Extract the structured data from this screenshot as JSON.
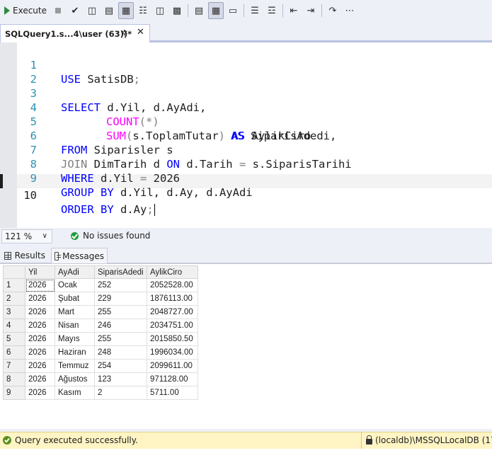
{
  "toolbar": {
    "execute_label": "Execute"
  },
  "tab": {
    "title": "SQLQuery1.s...4\\user (63))*",
    "pin": "✲",
    "close": "✕"
  },
  "editor": {
    "lines": [
      {
        "n": "1"
      },
      {
        "n": "2"
      },
      {
        "n": "3"
      },
      {
        "n": "4"
      },
      {
        "n": "5"
      },
      {
        "n": "6"
      },
      {
        "n": "7"
      },
      {
        "n": "8"
      },
      {
        "n": "9"
      },
      {
        "n": "10"
      }
    ],
    "tokens": {
      "use": "USE",
      "db": " SatisDB",
      "select": "SELECT",
      "sel_cols": " d.Yil, d.AyAdi,",
      "count": "COUNT",
      "count_args": "(*)",
      "as1": "AS",
      "alias1": " SiparisAdedi,",
      "sum": "SUM",
      "sum_args_open": "(",
      "sum_col": "s.ToplamTutar",
      "sum_args_close": ")",
      "as2": "AS",
      "alias2": " AylikCiro",
      "from": "FROM",
      "from_tbl": " Siparisler s",
      "join": "JOIN",
      "join_tbl": " DimTarih d ",
      "on": "ON",
      "join_cond": " d.Tarih ",
      "eq": "=",
      "join_cond2": " s.SiparisTarihi",
      "where": "WHERE",
      "where_col": " d.Yil ",
      "where_val": " 2026",
      "group": "GROUP BY",
      "group_cols": " d.Yil, d.Ay, d.AyAdi",
      "order": "ORDER BY",
      "order_cols": " d.Ay",
      "semicolon": ";"
    }
  },
  "editor_status": {
    "zoom": "121 %",
    "issues": "No issues found"
  },
  "results_tabs": {
    "results": "Results",
    "messages": "Messages"
  },
  "results": {
    "columns": [
      "",
      "Yil",
      "AyAdi",
      "SiparisAdedi",
      "AylikCiro"
    ],
    "rows": [
      [
        "1",
        "2026",
        "Ocak",
        "252",
        "2052528.00"
      ],
      [
        "2",
        "2026",
        "Şubat",
        "229",
        "1876113.00"
      ],
      [
        "3",
        "2026",
        "Mart",
        "255",
        "2048727.00"
      ],
      [
        "4",
        "2026",
        "Nisan",
        "246",
        "2034751.00"
      ],
      [
        "5",
        "2026",
        "Mayıs",
        "255",
        "2015850.50"
      ],
      [
        "6",
        "2026",
        "Haziran",
        "248",
        "1996034.00"
      ],
      [
        "7",
        "2026",
        "Temmuz",
        "254",
        "2099611.00"
      ],
      [
        "8",
        "2026",
        "Ağustos",
        "123",
        "971128.00"
      ],
      [
        "9",
        "2026",
        "Kasım",
        "2",
        "5711.00"
      ]
    ]
  },
  "statusbar": {
    "message": "Query executed successfully.",
    "server": "(localdb)\\MSSQLLocalDB (17..."
  }
}
